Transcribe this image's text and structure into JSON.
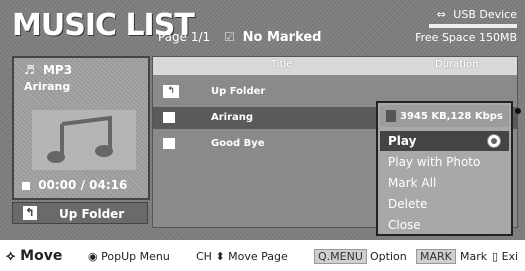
{
  "header": {
    "title": "MUSIC LIST",
    "page": "Page 1/1",
    "marked": "No Marked",
    "device": "USB Device",
    "free_space": "Free Space 150MB"
  },
  "now_playing": {
    "type": "MP3",
    "song": "Arirang",
    "time": "00:00 / 04:16"
  },
  "up_folder_button": "Up Folder",
  "list": {
    "columns": [
      "Title",
      "Duration"
    ],
    "rows": [
      {
        "name": "Up Folder",
        "type": "folder"
      },
      {
        "name": "Arirang",
        "type": "file",
        "selected": true
      },
      {
        "name": "Good Bye",
        "type": "file"
      }
    ]
  },
  "popup": {
    "info": "3945 KB,128 Kbps",
    "items": [
      "Play",
      "Play with Photo",
      "Mark All",
      "Delete",
      "Close"
    ]
  },
  "footer": {
    "move": "Move",
    "popup_menu": "PopUp Menu",
    "ch": "CH",
    "move_page": "Move Page",
    "qmenu": "Q.MENU",
    "option": "Option",
    "mark_key": "MARK",
    "mark": "Mark",
    "exit": "Exi"
  }
}
